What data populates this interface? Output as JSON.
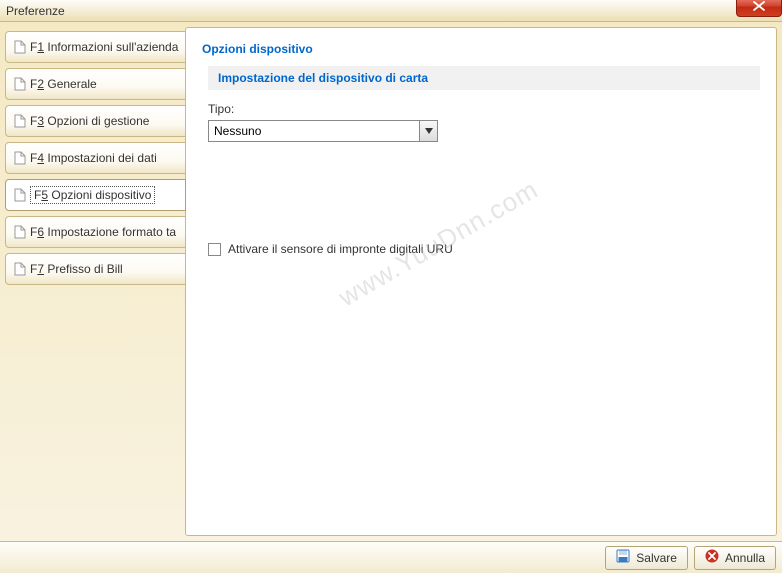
{
  "window": {
    "title": "Preferenze"
  },
  "sidebar": {
    "tabs": [
      {
        "key": "1",
        "text": "Informazioni sull'azienda"
      },
      {
        "key": "2",
        "text": "Generale"
      },
      {
        "key": "3",
        "text": "Opzioni di gestione"
      },
      {
        "key": "4",
        "text": "Impostazioni dei dati"
      },
      {
        "key": "5",
        "text": "Opzioni dispositivo"
      },
      {
        "key": "6",
        "text": "Impostazione formato ta"
      },
      {
        "key": "7",
        "text": "Prefisso di Bill"
      }
    ],
    "selected_index": 4
  },
  "content": {
    "title": "Opzioni dispositivo",
    "subsection_title": "Impostazione del dispositivo di carta",
    "type_label": "Tipo:",
    "type_value": "Nessuno",
    "checkbox_label": "Attivare il sensore di impronte digitali URU",
    "checkbox_checked": false
  },
  "footer": {
    "save_label": "Salvare",
    "cancel_label": "Annulla"
  },
  "watermark": "www.YuuDnn.com"
}
